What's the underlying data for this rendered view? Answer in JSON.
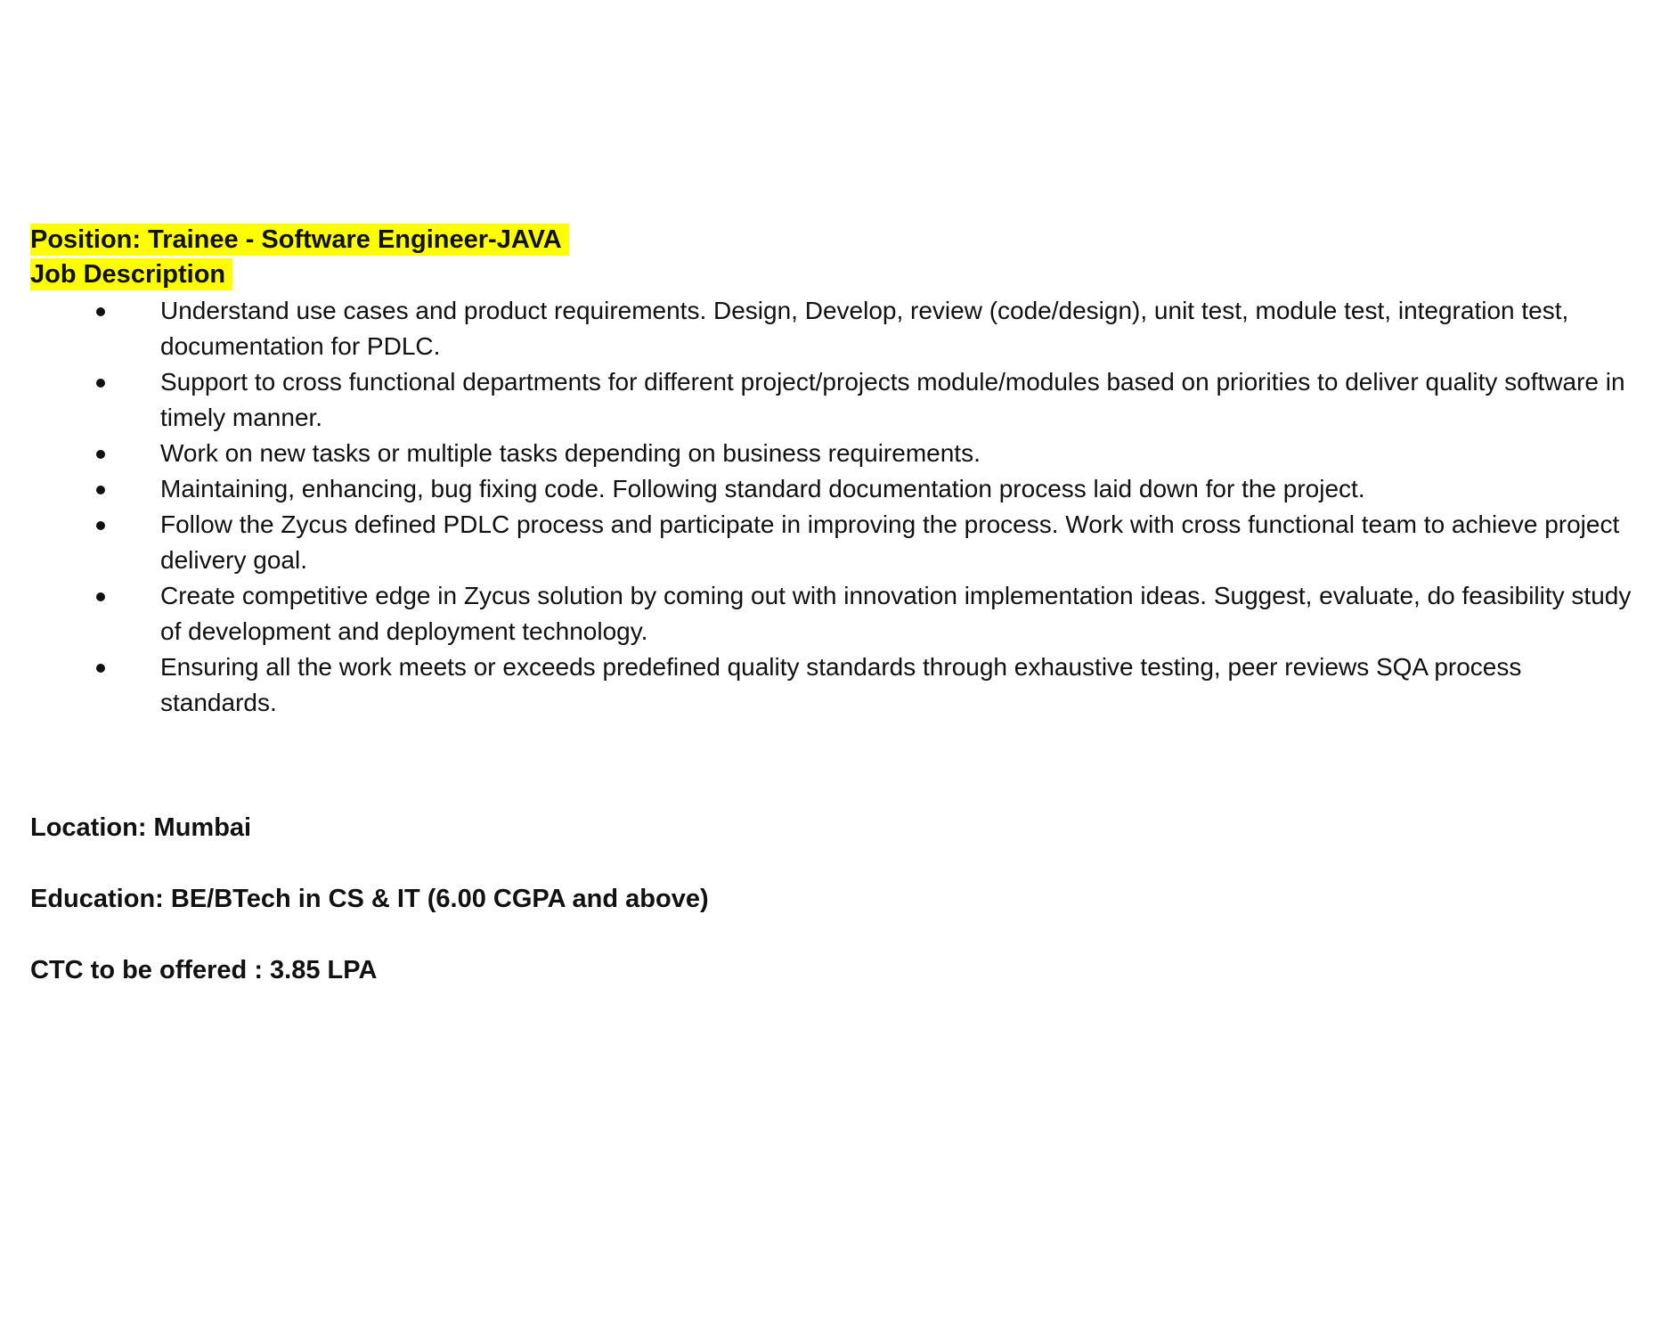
{
  "document": {
    "position": "Position: Trainee - Software Engineer-JAVA",
    "job_description_heading": "Job Description",
    "bullets": [
      "Understand use cases and product requirements. Design, Develop, review (code/design), unit test, module test, integration test, documentation for PDLC.",
      "Support to cross functional departments for different project/projects module/modules based on priorities to deliver quality software in timely manner.",
      "Work on new tasks or multiple tasks depending on business requirements.",
      "Maintaining, enhancing, bug fixing code. Following standard documentation process laid down for the project.",
      "Follow the Zycus defined PDLC process and participate in improving the process. Work with cross functional team to achieve project delivery goal.",
      "Create competitive edge in Zycus solution by coming out with innovation implementation ideas. Suggest, evaluate, do feasibility study of development and deployment technology.",
      "Ensuring all the work meets or exceeds predefined quality standards through exhaustive testing, peer reviews SQA process standards."
    ],
    "location": "Location: Mumbai",
    "education": "Education: BE/BTech in CS & IT (6.00 CGPA and above)",
    "ctc": "CTC to be offered : 3.85 LPA"
  },
  "colors": {
    "highlight": "#ffff00",
    "text": "#111111",
    "background": "#ffffff"
  }
}
